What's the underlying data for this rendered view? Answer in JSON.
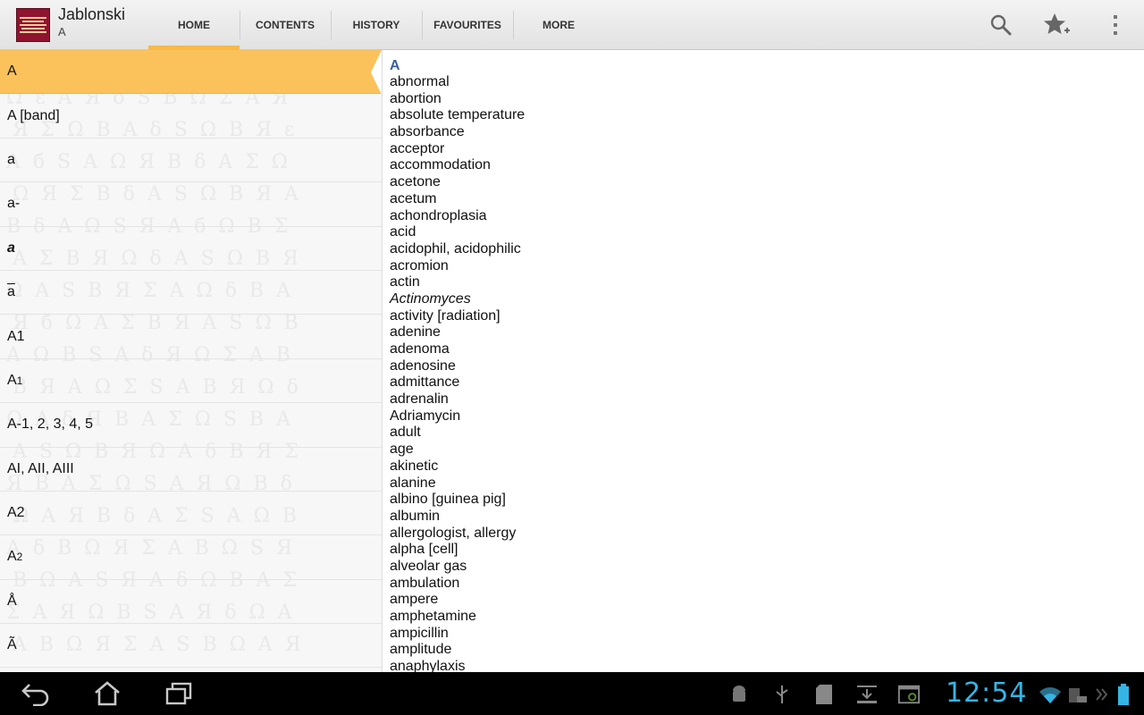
{
  "app": {
    "title": "Jablonski",
    "subtitle": "A",
    "icon_name": "jablonski-book-icon"
  },
  "tabs": [
    {
      "label": "HOME",
      "active": true
    },
    {
      "label": "CONTENTS",
      "active": false
    },
    {
      "label": "HISTORY",
      "active": false
    },
    {
      "label": "FAVOURITES",
      "active": false
    },
    {
      "label": "MORE",
      "active": false
    }
  ],
  "actions": [
    "search-icon",
    "star-add-icon",
    "overflow-menu-icon"
  ],
  "word_list": [
    {
      "text": "A",
      "selected": true
    },
    {
      "text": "A [band]"
    },
    {
      "text": "a"
    },
    {
      "text": "a-"
    },
    {
      "text": "a",
      "style": "bold-italic"
    },
    {
      "text": "a",
      "overbar": true
    },
    {
      "text": "A1"
    },
    {
      "text": "A",
      "sub": "1"
    },
    {
      "text": "A-1, 2, 3, 4, 5"
    },
    {
      "text": "AI, AII, AIII"
    },
    {
      "text": "A2"
    },
    {
      "text": "A",
      "sub": "2"
    },
    {
      "text": "Å"
    },
    {
      "text": "Ã"
    }
  ],
  "content": {
    "index_letter": "A",
    "entries": [
      "abnormal",
      "abortion",
      "absolute temperature",
      "absorbance",
      "acceptor",
      "accommodation",
      "acetone",
      "acetum",
      "achondroplasia",
      "acid",
      "acidophil, acidophilic",
      "acromion",
      "actin",
      "Actinomyces",
      "activity [radiation]",
      "adenine",
      "adenoma",
      "adenosine",
      "admittance",
      "adrenalin",
      "Adriamycin",
      "adult",
      "age",
      "akinetic",
      "alanine",
      "albino [guinea pig]",
      "albumin",
      "allergologist, allergy",
      "alpha [cell]",
      "alveolar gas",
      "ambulation",
      "ampere",
      "amphetamine",
      "ampicillin",
      "amplitude",
      "anaphylaxis"
    ],
    "italic_entries": [
      "Actinomyces"
    ]
  },
  "system_bar": {
    "clock": "12:54",
    "accent": "#34b5e5",
    "nav": [
      "back-icon",
      "home-icon",
      "recent-apps-icon"
    ],
    "tray": [
      "android-debug-icon",
      "usb-icon",
      "sd-card-icon",
      "download-icon",
      "screenshot-icon",
      "wifi-icon",
      "keyboard-icon",
      "battery-icon"
    ]
  },
  "colors": {
    "selected_row": "#fbc25c",
    "active_tab_indicator": "#f6b94a",
    "index_letter": "#3a5f9e"
  }
}
